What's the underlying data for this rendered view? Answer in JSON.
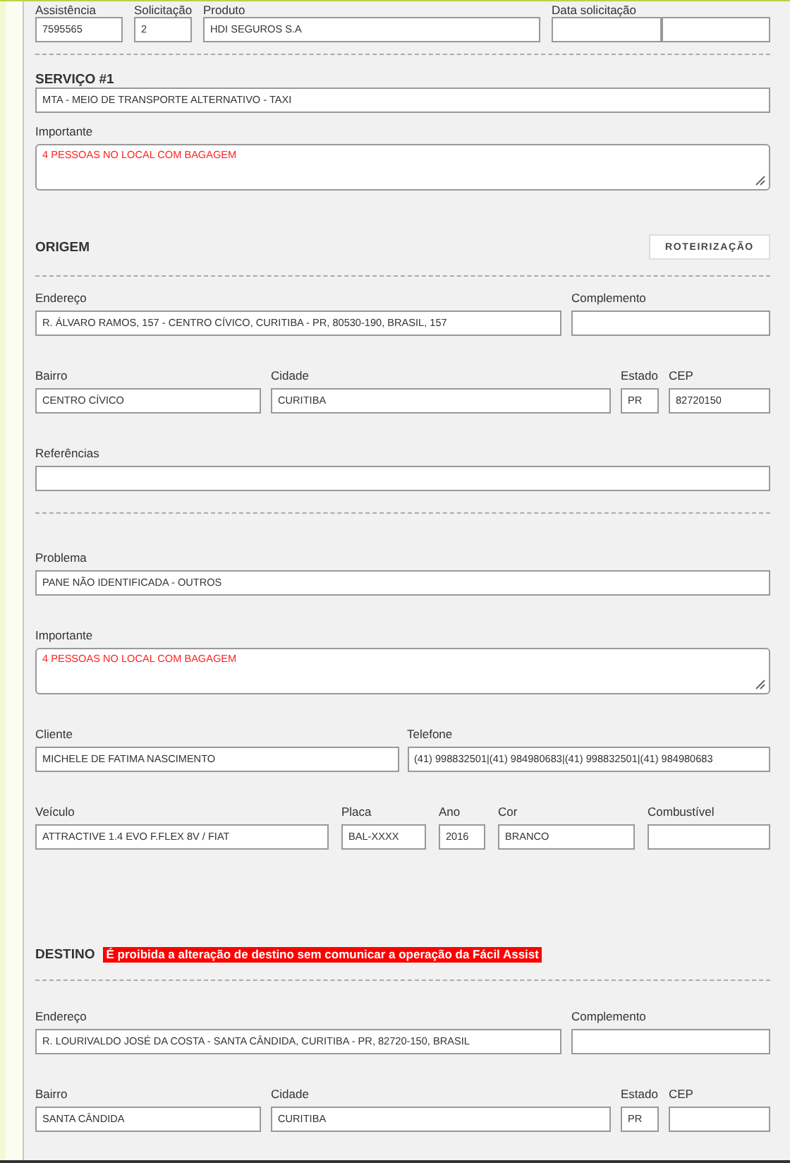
{
  "sections": [
    {
      "fields": [
        {
          "label": "Assistência",
          "kind": "input",
          "value": "7595565"
        },
        {
          "label": "Solicitação",
          "kind": "input",
          "value": "2"
        },
        {
          "label": "Produto",
          "kind": "input",
          "value": "HDI SEGUROS S.A"
        },
        {
          "label": "Data solicitação",
          "kind": "split"
        }
      ]
    },
    {
      "title": "SERVIÇO #1",
      "fields": [
        {
          "kind": "input",
          "value": "MTA - MEIO DE TRANSPORTE ALTERNATIVO - TAXI"
        },
        {
          "label": "Importante",
          "kind": "note",
          "value": "4 PESSOAS NO LOCAL COM BAGAGEM"
        }
      ]
    },
    {
      "title": "ORIGEM",
      "button": "ROTEIRIZAÇÃO",
      "fields": [
        {
          "label": "Endereço",
          "kind": "input",
          "value": "R. ÁLVARO RAMOS, 157 - CENTRO CÍVICO, CURITIBA - PR, 80530-190, BRASIL, 157"
        },
        {
          "label": "Complemento",
          "kind": "input"
        },
        {
          "label": "Bairro",
          "kind": "input",
          "value": "CENTRO CÍVICO"
        },
        {
          "label": "Cidade",
          "kind": "input",
          "value": "CURITIBA"
        },
        {
          "label": "Estado",
          "kind": "input",
          "value": "PR"
        },
        {
          "label": "CEP",
          "kind": "input",
          "value": "82720150"
        },
        {
          "label": "Referências",
          "kind": "input"
        }
      ]
    },
    {
      "fields": [
        {
          "label": "Problema",
          "kind": "input",
          "value": "PANE NÃO IDENTIFICADA - OUTROS"
        },
        {
          "label": "Importante",
          "kind": "note",
          "value": "4 PESSOAS NO LOCAL COM BAGAGEM"
        },
        {
          "label": "Cliente",
          "kind": "input",
          "value": "MICHELE DE FATIMA NASCIMENTO"
        },
        {
          "label": "Telefone",
          "kind": "input",
          "value": "(41) 998832501|(41) 984980683|(41) 998832501|(41) 984980683"
        },
        {
          "label": "Veículo",
          "kind": "input",
          "value": "ATTRACTIVE 1.4 EVO F.FLEX 8V / FIAT"
        },
        {
          "label": "Placa",
          "kind": "input",
          "value": "BAL-XXXX"
        },
        {
          "label": "Ano",
          "kind": "input",
          "value": "2016"
        },
        {
          "label": "Cor",
          "kind": "input",
          "value": "BRANCO"
        },
        {
          "label": "Combustível",
          "kind": "input"
        }
      ]
    },
    {
      "title": "DESTINO",
      "warning": "É proibida a alteração de destino sem comunicar a operação da Fácil Assist",
      "fields": [
        {
          "label": "Endereço",
          "kind": "input",
          "value": "R. LOURIVALDO JOSÉ DA COSTA - SANTA CÂNDIDA, CURITIBA - PR, 82720-150, BRASIL"
        },
        {
          "label": "Complemento",
          "kind": "input"
        },
        {
          "label": "Bairro",
          "kind": "input",
          "value": "SANTA CÂNDIDA"
        },
        {
          "label": "Cidade",
          "kind": "input",
          "value": "CURITIBA"
        },
        {
          "label": "Estado",
          "kind": "input",
          "value": "PR"
        },
        {
          "label": "CEP",
          "kind": "input"
        }
      ]
    }
  ]
}
